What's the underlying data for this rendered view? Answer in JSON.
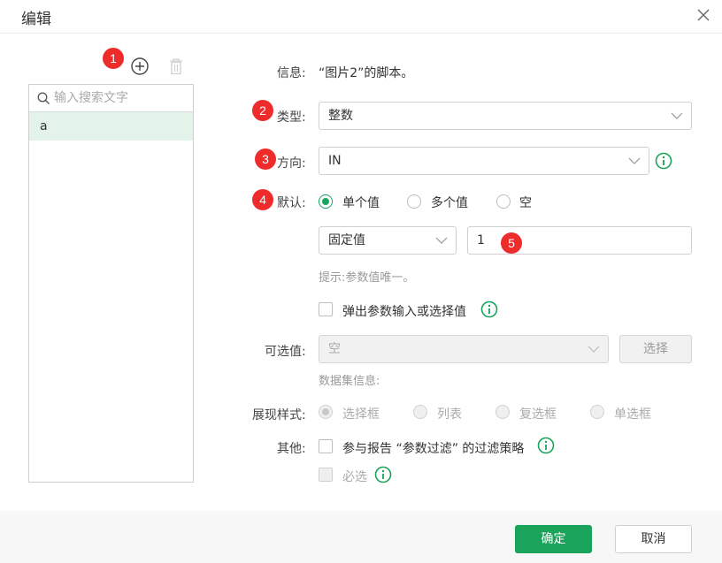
{
  "dialog": {
    "title": "编辑"
  },
  "left_panel": {
    "search_placeholder": "输入搜索文字",
    "items": [
      {
        "label": "a"
      }
    ]
  },
  "badges": [
    "1",
    "2",
    "3",
    "4",
    "5"
  ],
  "form": {
    "info": {
      "label": "信息:",
      "value": "“图片2”的脚本。"
    },
    "type": {
      "label": "类型:",
      "value": "整数"
    },
    "direction": {
      "label": "方向:",
      "value": "IN"
    },
    "default": {
      "label": "默认:",
      "options": [
        "单个值",
        "多个值",
        "空"
      ],
      "selected": "单个值",
      "source": "固定值",
      "value": "1",
      "hint": "提示:参数值唯一。"
    },
    "popup_checkbox": "弹出参数输入或选择值",
    "optional": {
      "label": "可选值:",
      "value": "空",
      "select_button": "选择",
      "dataset_info": "数据集信息:"
    },
    "display_style": {
      "label": "展现样式:",
      "options": [
        "选择框",
        "列表",
        "复选框",
        "单选框"
      ],
      "selected": "选择框"
    },
    "other": {
      "label": "其他:",
      "report_filter": "参与报告 “参数过滤” 的过滤策略",
      "required": "必选"
    }
  },
  "footer": {
    "ok": "确定",
    "cancel": "取消"
  },
  "colors": {
    "accent": "#1aa35a",
    "badge": "#ee2c2c",
    "selected_row": "#e4f3ea"
  }
}
